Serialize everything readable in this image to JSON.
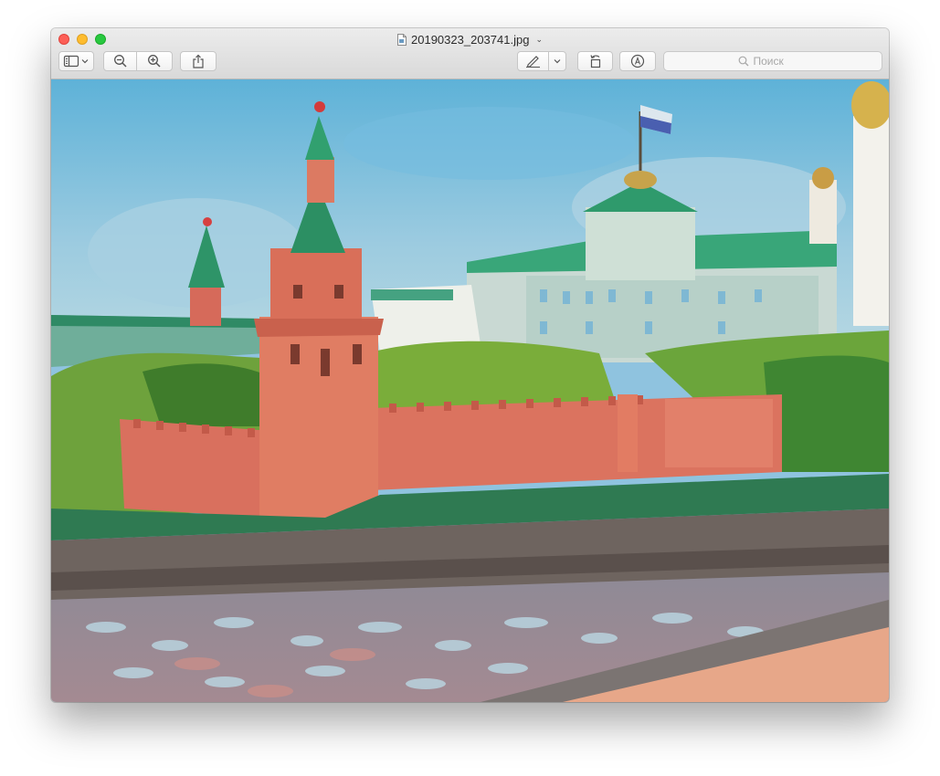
{
  "window": {
    "title": "20190323_203741.jpg",
    "title_icon": "document-icon"
  },
  "toolbar": {
    "sidebar_toggle_icon": "sidebar-icon",
    "zoom_out_icon": "zoom-out-icon",
    "zoom_in_icon": "zoom-in-icon",
    "share_icon": "share-icon",
    "markup_icon": "pen-icon",
    "rotate_icon": "rotate-left-icon",
    "annotate_icon": "markup-circle-icon"
  },
  "search": {
    "placeholder": "Поиск",
    "value": ""
  },
  "colors": {
    "close": "#fd5f57",
    "minimize": "#febc2e",
    "maximize": "#28c840",
    "wall": "#d9705e",
    "roof": "#2d9a6d",
    "sky": "#8fc3df"
  }
}
